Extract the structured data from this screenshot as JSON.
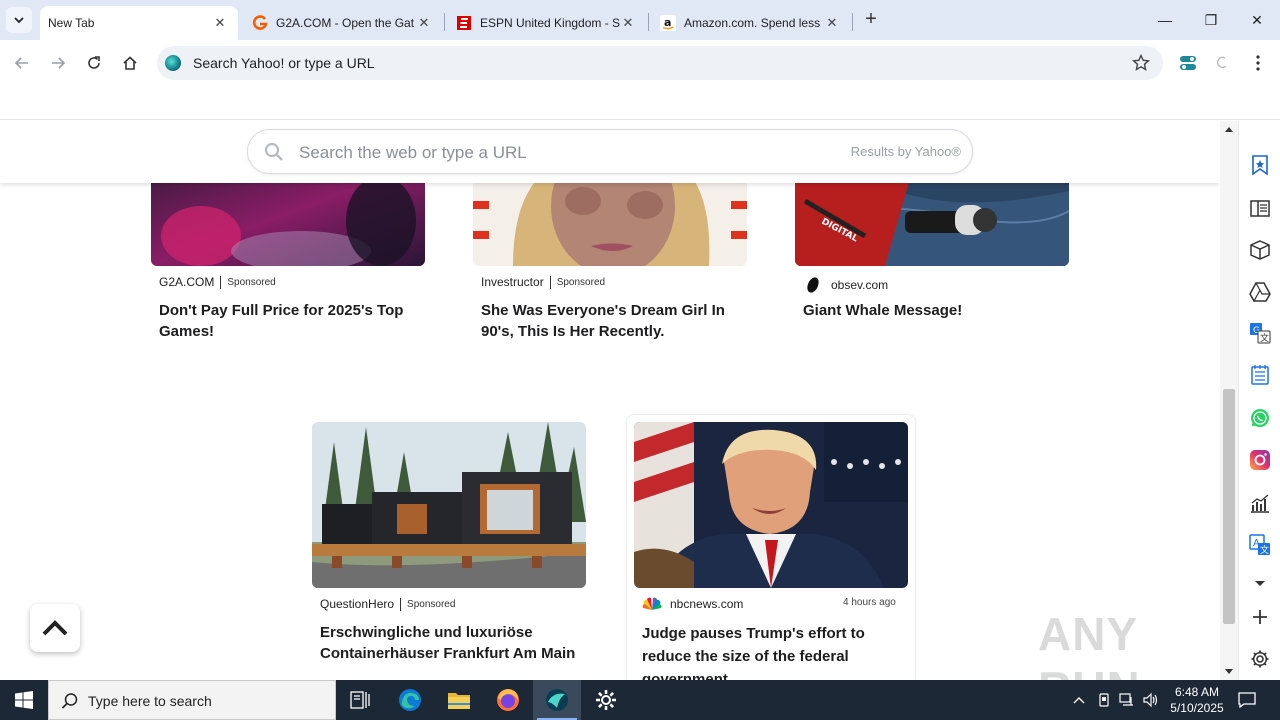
{
  "tabs": [
    {
      "title": "New Tab",
      "active": true
    },
    {
      "title": "G2A.COM - Open the Gat",
      "active": false
    },
    {
      "title": "ESPN United Kingdom - S",
      "active": false
    },
    {
      "title": "Amazon.com. Spend less",
      "active": false
    }
  ],
  "window": {
    "minimize": "—",
    "restore": "❐",
    "close": "✕"
  },
  "omnibox": {
    "placeholder": "Search Yahoo! or type a URL"
  },
  "page_search": {
    "placeholder": "Search the web or type a URL",
    "results_by": "Results by Yahoo®"
  },
  "cards": [
    {
      "source": "G2A.COM",
      "sponsored": "Sponsored",
      "headline": "Don't Pay Full Price for 2025's Top Games!"
    },
    {
      "source": "Investructor",
      "sponsored": "Sponsored",
      "headline": "She Was Everyone's Dream Girl In 90's, This Is Her Recently."
    },
    {
      "source": "obsev.com",
      "sponsored": "",
      "headline": "Giant Whale Message!"
    },
    {
      "source": "QuestionHero",
      "sponsored": "Sponsored",
      "headline": "Erschwingliche und luxuriöse Containerhäuser Frankfurt Am Main"
    },
    {
      "source": "nbcnews.com",
      "time": "4 hours ago",
      "headline": "Judge pauses Trump's effort to reduce the size of the federal government"
    }
  ],
  "watermark": "ANY RUN",
  "taskbar": {
    "search_placeholder": "Type here to search",
    "time": "6:48 AM",
    "date": "5/10/2025"
  },
  "colors": {
    "accent": "#1a73e8",
    "taskbar": "#1c2836",
    "tabstrip": "#dfe8f4"
  }
}
